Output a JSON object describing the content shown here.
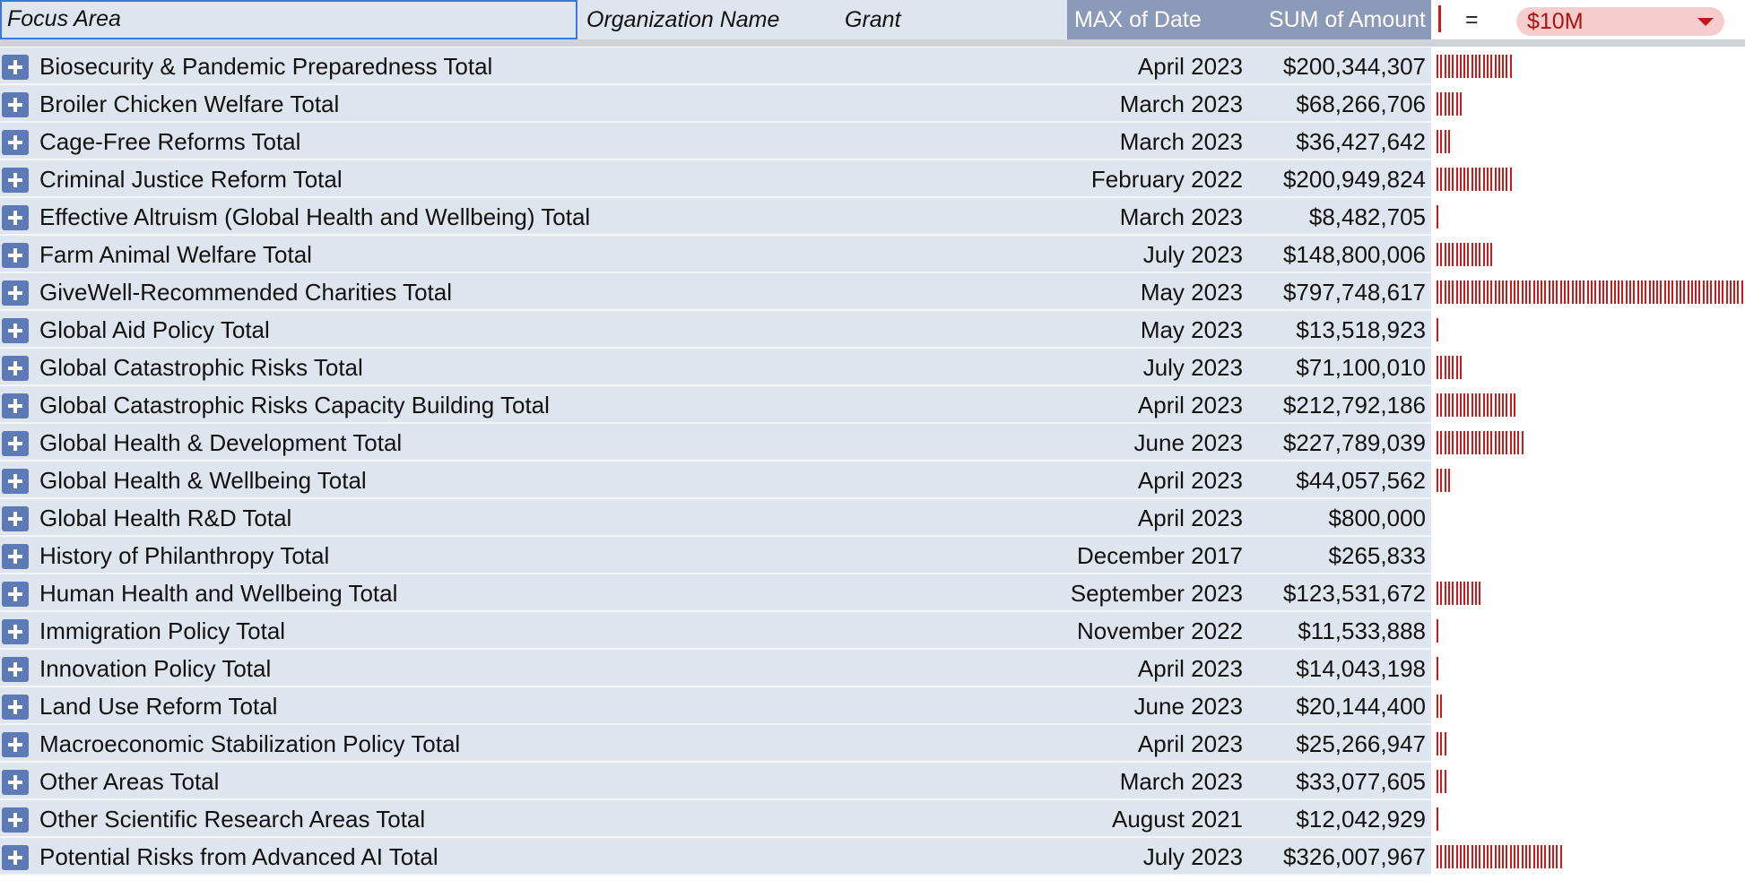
{
  "header": {
    "focus_area": "Focus Area",
    "organization_name": "Organization Name",
    "grant": "Grant",
    "max_of_date": "MAX of Date",
    "sum_of_amount": "SUM of Amount",
    "equals": "=",
    "scale_value": "$10M"
  },
  "colors": {
    "header_band": "#dfe5ee",
    "value_header": "#8a9ab8",
    "spark": "#d01818",
    "expand_button": "#5d7ab7"
  },
  "icons": {
    "expand": "plus-box-icon",
    "scale_dropdown": "caret-down-icon"
  },
  "rows": [
    {
      "label": "Biosecurity & Pandemic Preparedness Total",
      "date": "April 2023",
      "amount": "$200,344,307",
      "bars": 20
    },
    {
      "label": "Broiler Chicken Welfare Total",
      "date": "March 2023",
      "amount": "$68,266,706",
      "bars": 7
    },
    {
      "label": "Cage-Free Reforms Total",
      "date": "March 2023",
      "amount": "$36,427,642",
      "bars": 4
    },
    {
      "label": "Criminal Justice Reform Total",
      "date": "February 2022",
      "amount": "$200,949,824",
      "bars": 20
    },
    {
      "label": "Effective Altruism (Global Health and Wellbeing) Total",
      "date": "March 2023",
      "amount": "$8,482,705",
      "bars": 1
    },
    {
      "label": "Farm Animal Welfare Total",
      "date": "July 2023",
      "amount": "$148,800,006",
      "bars": 15
    },
    {
      "label": "GiveWell-Recommended Charities Total",
      "date": "May 2023",
      "amount": "$797,748,617",
      "bars": 80
    },
    {
      "label": "Global Aid Policy Total",
      "date": "May 2023",
      "amount": "$13,518,923",
      "bars": 1
    },
    {
      "label": "Global Catastrophic Risks Total",
      "date": "July 2023",
      "amount": "$71,100,010",
      "bars": 7
    },
    {
      "label": "Global Catastrophic Risks Capacity Building Total",
      "date": "April 2023",
      "amount": "$212,792,186",
      "bars": 21
    },
    {
      "label": "Global Health & Development Total",
      "date": "June 2023",
      "amount": "$227,789,039",
      "bars": 23
    },
    {
      "label": "Global Health & Wellbeing Total",
      "date": "April 2023",
      "amount": "$44,057,562",
      "bars": 4
    },
    {
      "label": "Global Health R&D Total",
      "date": "April 2023",
      "amount": "$800,000",
      "bars": 0
    },
    {
      "label": "History of Philanthropy Total",
      "date": "December 2017",
      "amount": "$265,833",
      "bars": 0
    },
    {
      "label": "Human Health and Wellbeing Total",
      "date": "September 2023",
      "amount": "$123,531,672",
      "bars": 12
    },
    {
      "label": "Immigration Policy Total",
      "date": "November 2022",
      "amount": "$11,533,888",
      "bars": 1
    },
    {
      "label": "Innovation Policy Total",
      "date": "April 2023",
      "amount": "$14,043,198",
      "bars": 1
    },
    {
      "label": "Land Use Reform Total",
      "date": "June 2023",
      "amount": "$20,144,400",
      "bars": 2
    },
    {
      "label": "Macroeconomic Stabilization Policy Total",
      "date": "April 2023",
      "amount": "$25,266,947",
      "bars": 3
    },
    {
      "label": "Other Areas Total",
      "date": "March 2023",
      "amount": "$33,077,605",
      "bars": 3
    },
    {
      "label": "Other Scientific Research Areas Total",
      "date": "August 2021",
      "amount": "$12,042,929",
      "bars": 1
    },
    {
      "label": "Potential Risks from Advanced AI Total",
      "date": "July 2023",
      "amount": "$326,007,967",
      "bars": 33
    }
  ]
}
